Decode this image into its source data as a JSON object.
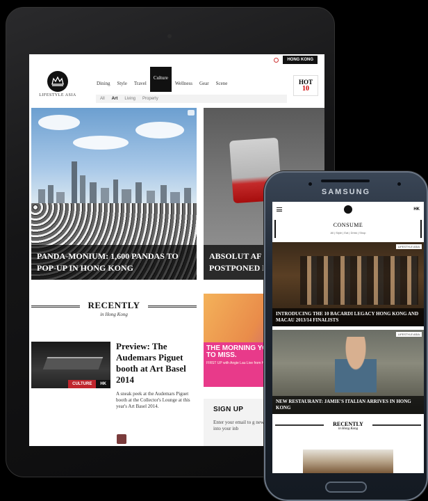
{
  "tablet": {
    "topbar": {
      "region": "HONG KONG"
    },
    "logo": {
      "text": "LIFESTYLE ASIA"
    },
    "nav": {
      "items": [
        "Dining",
        "Style",
        "Travel",
        "Culture",
        "Wellness",
        "Gear",
        "Scene"
      ],
      "active": "Culture",
      "sub_items": [
        "All",
        "Art",
        "Living",
        "Property"
      ],
      "sub_active": "Art"
    },
    "hot10": {
      "hot": "HOT",
      "ten": "10"
    },
    "hero1": {
      "title": "PANDA-MONIUM: 1,600 PANDAS TO POP-UP IN HONG KONG"
    },
    "hero2": {
      "title": "ABSOLUT AF 2014: “APOC POSTPONED NADIM ABBA"
    },
    "recently": {
      "title": "RECENTLY",
      "subtitle": "in Hong Kong"
    },
    "article": {
      "tag_category": "CULTURE",
      "tag_region": "HK",
      "title": "Preview: The Audemars Piguet booth at Art Basel 2014",
      "description": "A sneak peek at the Audemars Piguet booth at the Collector's Lounge at this year's Art Basel 2014."
    },
    "ad": {
      "headline": "THE MORNING YOU WON'T WA TO MISS.",
      "sub": "FIRST UP with Angie Lau Live from Hong Kong Weekdays 7am SIN/HK"
    },
    "signup": {
      "title": "SIGN UP",
      "description": "Enter your email to g news from LifestyleA weekly into your inb"
    }
  },
  "phone": {
    "brand": "SAMSUNG",
    "region_code": "HK",
    "section": "CONSUME",
    "filters": "All | Style | Eat | Drink | Shop",
    "story1": {
      "badge": "LIFESTYLE ASIA",
      "title": "INTRODUCING THE 10 BACARDI LEGACY HONG KONG AND MACAU 2013/14 FINALISTS"
    },
    "story2": {
      "badge": "LIFESTYLE ASIA",
      "title": "NEW RESTAURANT: JAMIE'S ITALIAN ARRIVES IN HONG KONG"
    },
    "recently": {
      "title": "RECENTLY",
      "subtitle": "in Hong Kong"
    }
  }
}
